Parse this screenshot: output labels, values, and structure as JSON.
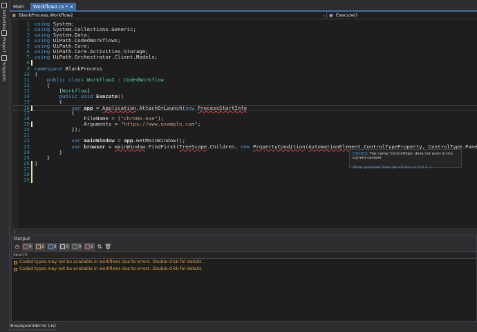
{
  "sidebar": {
    "items": [
      {
        "label": "Activities"
      },
      {
        "label": "Project"
      },
      {
        "label": "Snippets"
      }
    ]
  },
  "tabs": [
    {
      "label": "Main"
    },
    {
      "label": "Workflow2.cs *",
      "close": "×"
    }
  ],
  "nav": {
    "class_path": "BlankProcess.Workflow2",
    "member": "Execute()"
  },
  "code": [
    [
      [
        "using ",
        "k"
      ],
      [
        "System;",
        "p"
      ]
    ],
    [
      [
        "using ",
        "k"
      ],
      [
        "System.Collections.Generic;",
        "p"
      ]
    ],
    [
      [
        "using ",
        "k"
      ],
      [
        "System.Data;",
        "p"
      ]
    ],
    [
      [
        "using ",
        "k"
      ],
      [
        "UiPath.CodedWorkflows;",
        "p"
      ]
    ],
    [
      [
        "using ",
        "k"
      ],
      [
        "UiPath.Core;",
        "p"
      ]
    ],
    [
      [
        "using ",
        "k"
      ],
      [
        "UiPath.Core.Activities.Storage;",
        "p"
      ]
    ],
    [
      [
        "using ",
        "k"
      ],
      [
        "UiPath.Orchestrator.Client.Models;",
        "p"
      ]
    ],
    [],
    [
      [
        "namespace ",
        "k"
      ],
      [
        "BlankProcess",
        "p"
      ]
    ],
    [
      [
        "{",
        "p"
      ]
    ],
    [
      [
        "    public class ",
        "k"
      ],
      [
        "Workflow2",
        "ty"
      ],
      [
        " : ",
        "p"
      ],
      [
        "CodedWorkflow",
        "ty"
      ]
    ],
    [
      [
        "    {",
        "p"
      ]
    ],
    [
      [
        "        [",
        "p"
      ],
      [
        "Workflow",
        "ty"
      ],
      [
        "]",
        "p"
      ]
    ],
    [
      [
        "        public void ",
        "k"
      ],
      [
        "Execute",
        "v"
      ],
      [
        "()",
        "p"
      ]
    ],
    [
      [
        "        {",
        "p"
      ]
    ],
    [
      [
        "            var ",
        "k"
      ],
      [
        "app",
        "v"
      ],
      [
        " = ",
        "p"
      ],
      [
        "Application",
        "err p"
      ],
      [
        ".AttachOrLaunch(",
        "p"
      ],
      [
        "new ",
        "k"
      ],
      [
        "ProcessStartInfo",
        "err p"
      ]
    ],
    [
      [
        "            {",
        "p"
      ]
    ],
    [
      [
        "                FileName = (",
        "p"
      ],
      [
        "\"chrome.exe\"",
        "s"
      ],
      [
        ");",
        "p"
      ]
    ],
    [
      [
        "                Arguments = ",
        "p"
      ],
      [
        "\"https://www.example.com\"",
        "s"
      ],
      [
        ";",
        "p"
      ]
    ],
    [
      [
        "            });",
        "p"
      ]
    ],
    [],
    [
      [
        "            var ",
        "k"
      ],
      [
        "mainWindow",
        "v"
      ],
      [
        " = ",
        "p"
      ],
      [
        "app",
        "v"
      ],
      [
        ".GetMainWindow();",
        "p"
      ]
    ],
    [
      [
        "            var ",
        "k"
      ],
      [
        "browser",
        "v"
      ],
      [
        " = ",
        "p"
      ],
      [
        "mainWindow",
        "err p"
      ],
      [
        ".FindFirst(",
        "p"
      ],
      [
        "TreeScope",
        "err p"
      ],
      [
        ".Children, ",
        "p"
      ],
      [
        "new ",
        "k"
      ],
      [
        "PropertyCondition",
        "err p"
      ],
      [
        "(",
        "p"
      ],
      [
        "AutomationElement",
        "err p"
      ],
      [
        ".ControlTypeProperty, ",
        "p"
      ],
      [
        "ControlType",
        "err p"
      ],
      [
        ".Pane));",
        "p"
      ]
    ],
    [
      [
        "        }",
        "p"
      ]
    ],
    [
      [
        "    }",
        "p"
      ]
    ],
    [
      [
        "}",
        "p"
      ]
    ],
    [],
    [],
    []
  ],
  "line_numbers": [
    "1",
    "2",
    "3",
    "4",
    "5",
    "6",
    "7",
    "8",
    "9",
    "10",
    "11",
    "12",
    "13",
    "14",
    "15",
    "16",
    "17",
    "18",
    "19",
    "20",
    "21",
    "22",
    "23",
    "24",
    "25",
    "26",
    "27",
    "28",
    "29"
  ],
  "tooltip": {
    "error_code": "CS0103:",
    "message": " The name 'ControlType' does not exist in the current context",
    "fix": "Show potential fixes (Alt+Enter or Ctrl +.)"
  },
  "output": {
    "title": "Output",
    "filters": [
      {
        "icon": "warning-triangle-icon",
        "count": "0",
        "color": "#d16969"
      },
      {
        "icon": "warning-icon",
        "count": "2",
        "color": "#e8a23c"
      },
      {
        "icon": "info-icon",
        "count": "0",
        "color": "#569cd6"
      },
      {
        "icon": "trace-icon",
        "count": "0",
        "color": "#cccccc"
      },
      {
        "icon": "success-icon",
        "count": "0",
        "color": "#6aab73"
      },
      {
        "icon": "error-icon",
        "count": "0",
        "color": "#c86480"
      }
    ],
    "search_placeholder": "Search",
    "messages": [
      "Coded types may not be available in workflows due to errors. Double-click for details.",
      "Coded types may not be available in workflows due to errors. Double-click for details."
    ]
  },
  "bottom_tabs": [
    {
      "label": "Breakpoints"
    },
    {
      "label": "Error List"
    }
  ]
}
